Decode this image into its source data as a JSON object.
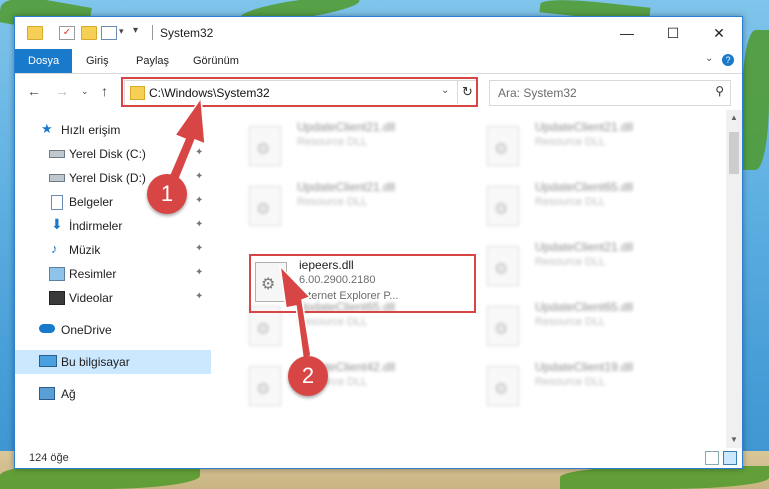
{
  "window": {
    "title": "System32",
    "controls": {
      "minimize": "—",
      "maximize": "☐",
      "close": "✕"
    }
  },
  "ribbon": {
    "tabs": [
      "Dosya",
      "Giriş",
      "Paylaş",
      "Görünüm"
    ],
    "collapse_icon": "chevron-down-icon",
    "help_icon": "help-icon"
  },
  "nav": {
    "address": "C:\\Windows\\System32",
    "search_placeholder": "Ara: System32"
  },
  "sidebar": {
    "items": [
      {
        "label": "Hızlı erişim",
        "icon": "star-icon"
      },
      {
        "label": "Yerel Disk (C:)",
        "icon": "drive-icon",
        "pinned": true
      },
      {
        "label": "Yerel Disk (D:)",
        "icon": "drive-icon",
        "pinned": true
      },
      {
        "label": "Belgeler",
        "icon": "documents-icon",
        "pinned": true
      },
      {
        "label": "İndirmeler",
        "icon": "download-icon",
        "pinned": true
      },
      {
        "label": "Müzik",
        "icon": "music-icon",
        "pinned": true
      },
      {
        "label": "Resimler",
        "icon": "pictures-icon",
        "pinned": true
      },
      {
        "label": "Videolar",
        "icon": "videos-icon",
        "pinned": true
      },
      {
        "label": "OneDrive",
        "icon": "cloud-icon"
      },
      {
        "label": "Bu bilgisayar",
        "icon": "computer-icon",
        "selected": true
      },
      {
        "label": "Ağ",
        "icon": "network-icon"
      }
    ]
  },
  "files": {
    "blurred": [
      {
        "name": "UpdateClient21.dll",
        "type": "Resource DLL"
      },
      {
        "name": "UpdateClient21.dll",
        "type": "Resource DLL"
      },
      {
        "name": "UpdateClient21.dll",
        "type": "Resource DLL"
      },
      {
        "name": "UpdateClient65.dll",
        "type": "Resource DLL"
      },
      {
        "name": "UpdateClient21.dll",
        "type": "Resource DLL"
      },
      {
        "name": "UpdateClient65.dll",
        "type": "Resource DLL"
      },
      {
        "name": "UpdateClient65.dll",
        "type": "Resource DLL"
      },
      {
        "name": "UpdateClient42.dll",
        "type": "Resource DLL"
      },
      {
        "name": "UpdateClient19.dll",
        "type": "Resource DLL"
      }
    ],
    "focused": {
      "name": "iepeers.dll",
      "version": "6.00.2900.2180",
      "description": "Internet Explorer P..."
    }
  },
  "status": {
    "item_count": "124 öğe"
  },
  "annotations": {
    "badge1": "1",
    "badge2": "2",
    "color": "#d84545"
  }
}
